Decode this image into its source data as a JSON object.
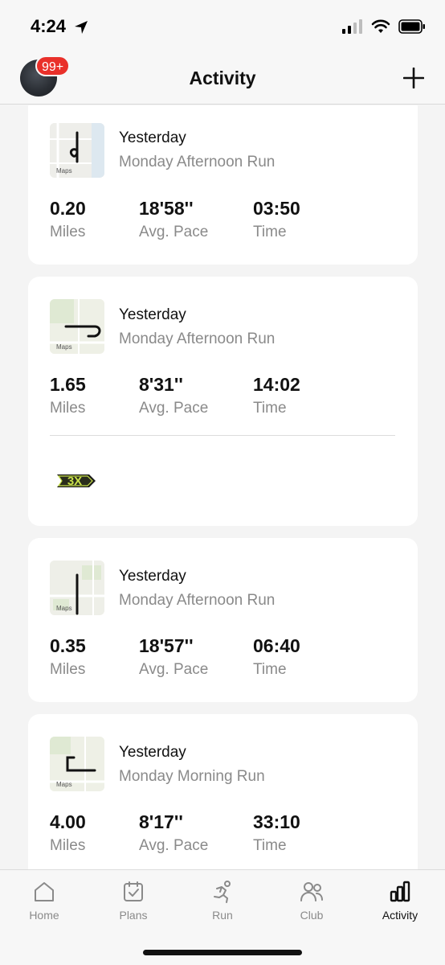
{
  "status": {
    "time": "4:24"
  },
  "header": {
    "title": "Activity",
    "badge": "99+"
  },
  "activities": [
    {
      "when": "Yesterday",
      "name": "Monday Afternoon Run",
      "map_label": "Maps",
      "miles": "0.20",
      "miles_label": "Miles",
      "pace": "18'58''",
      "pace_label": "Avg. Pace",
      "time": "03:50",
      "time_label": "Time"
    },
    {
      "when": "Yesterday",
      "name": "Monday Afternoon Run",
      "map_label": "Maps",
      "miles": "1.65",
      "miles_label": "Miles",
      "pace": "8'31''",
      "pace_label": "Avg. Pace",
      "time": "14:02",
      "time_label": "Time",
      "achievement": "3X"
    },
    {
      "when": "Yesterday",
      "name": "Monday Afternoon Run",
      "map_label": "Maps",
      "miles": "0.35",
      "miles_label": "Miles",
      "pace": "18'57''",
      "pace_label": "Avg. Pace",
      "time": "06:40",
      "time_label": "Time"
    },
    {
      "when": "Yesterday",
      "name": "Monday Morning Run",
      "map_label": "Maps",
      "miles": "4.00",
      "miles_label": "Miles",
      "pace": "8'17''",
      "pace_label": "Avg. Pace",
      "time": "33:10",
      "time_label": "Time"
    }
  ],
  "tabs": [
    {
      "label": "Home",
      "icon": "home-icon"
    },
    {
      "label": "Plans",
      "icon": "plans-icon"
    },
    {
      "label": "Run",
      "icon": "run-icon"
    },
    {
      "label": "Club",
      "icon": "club-icon"
    },
    {
      "label": "Activity",
      "icon": "activity-icon",
      "active": true
    }
  ],
  "colors": {
    "badge": "#e9302a",
    "achievement": "#c8e04a",
    "muted": "#8a8a8a"
  }
}
